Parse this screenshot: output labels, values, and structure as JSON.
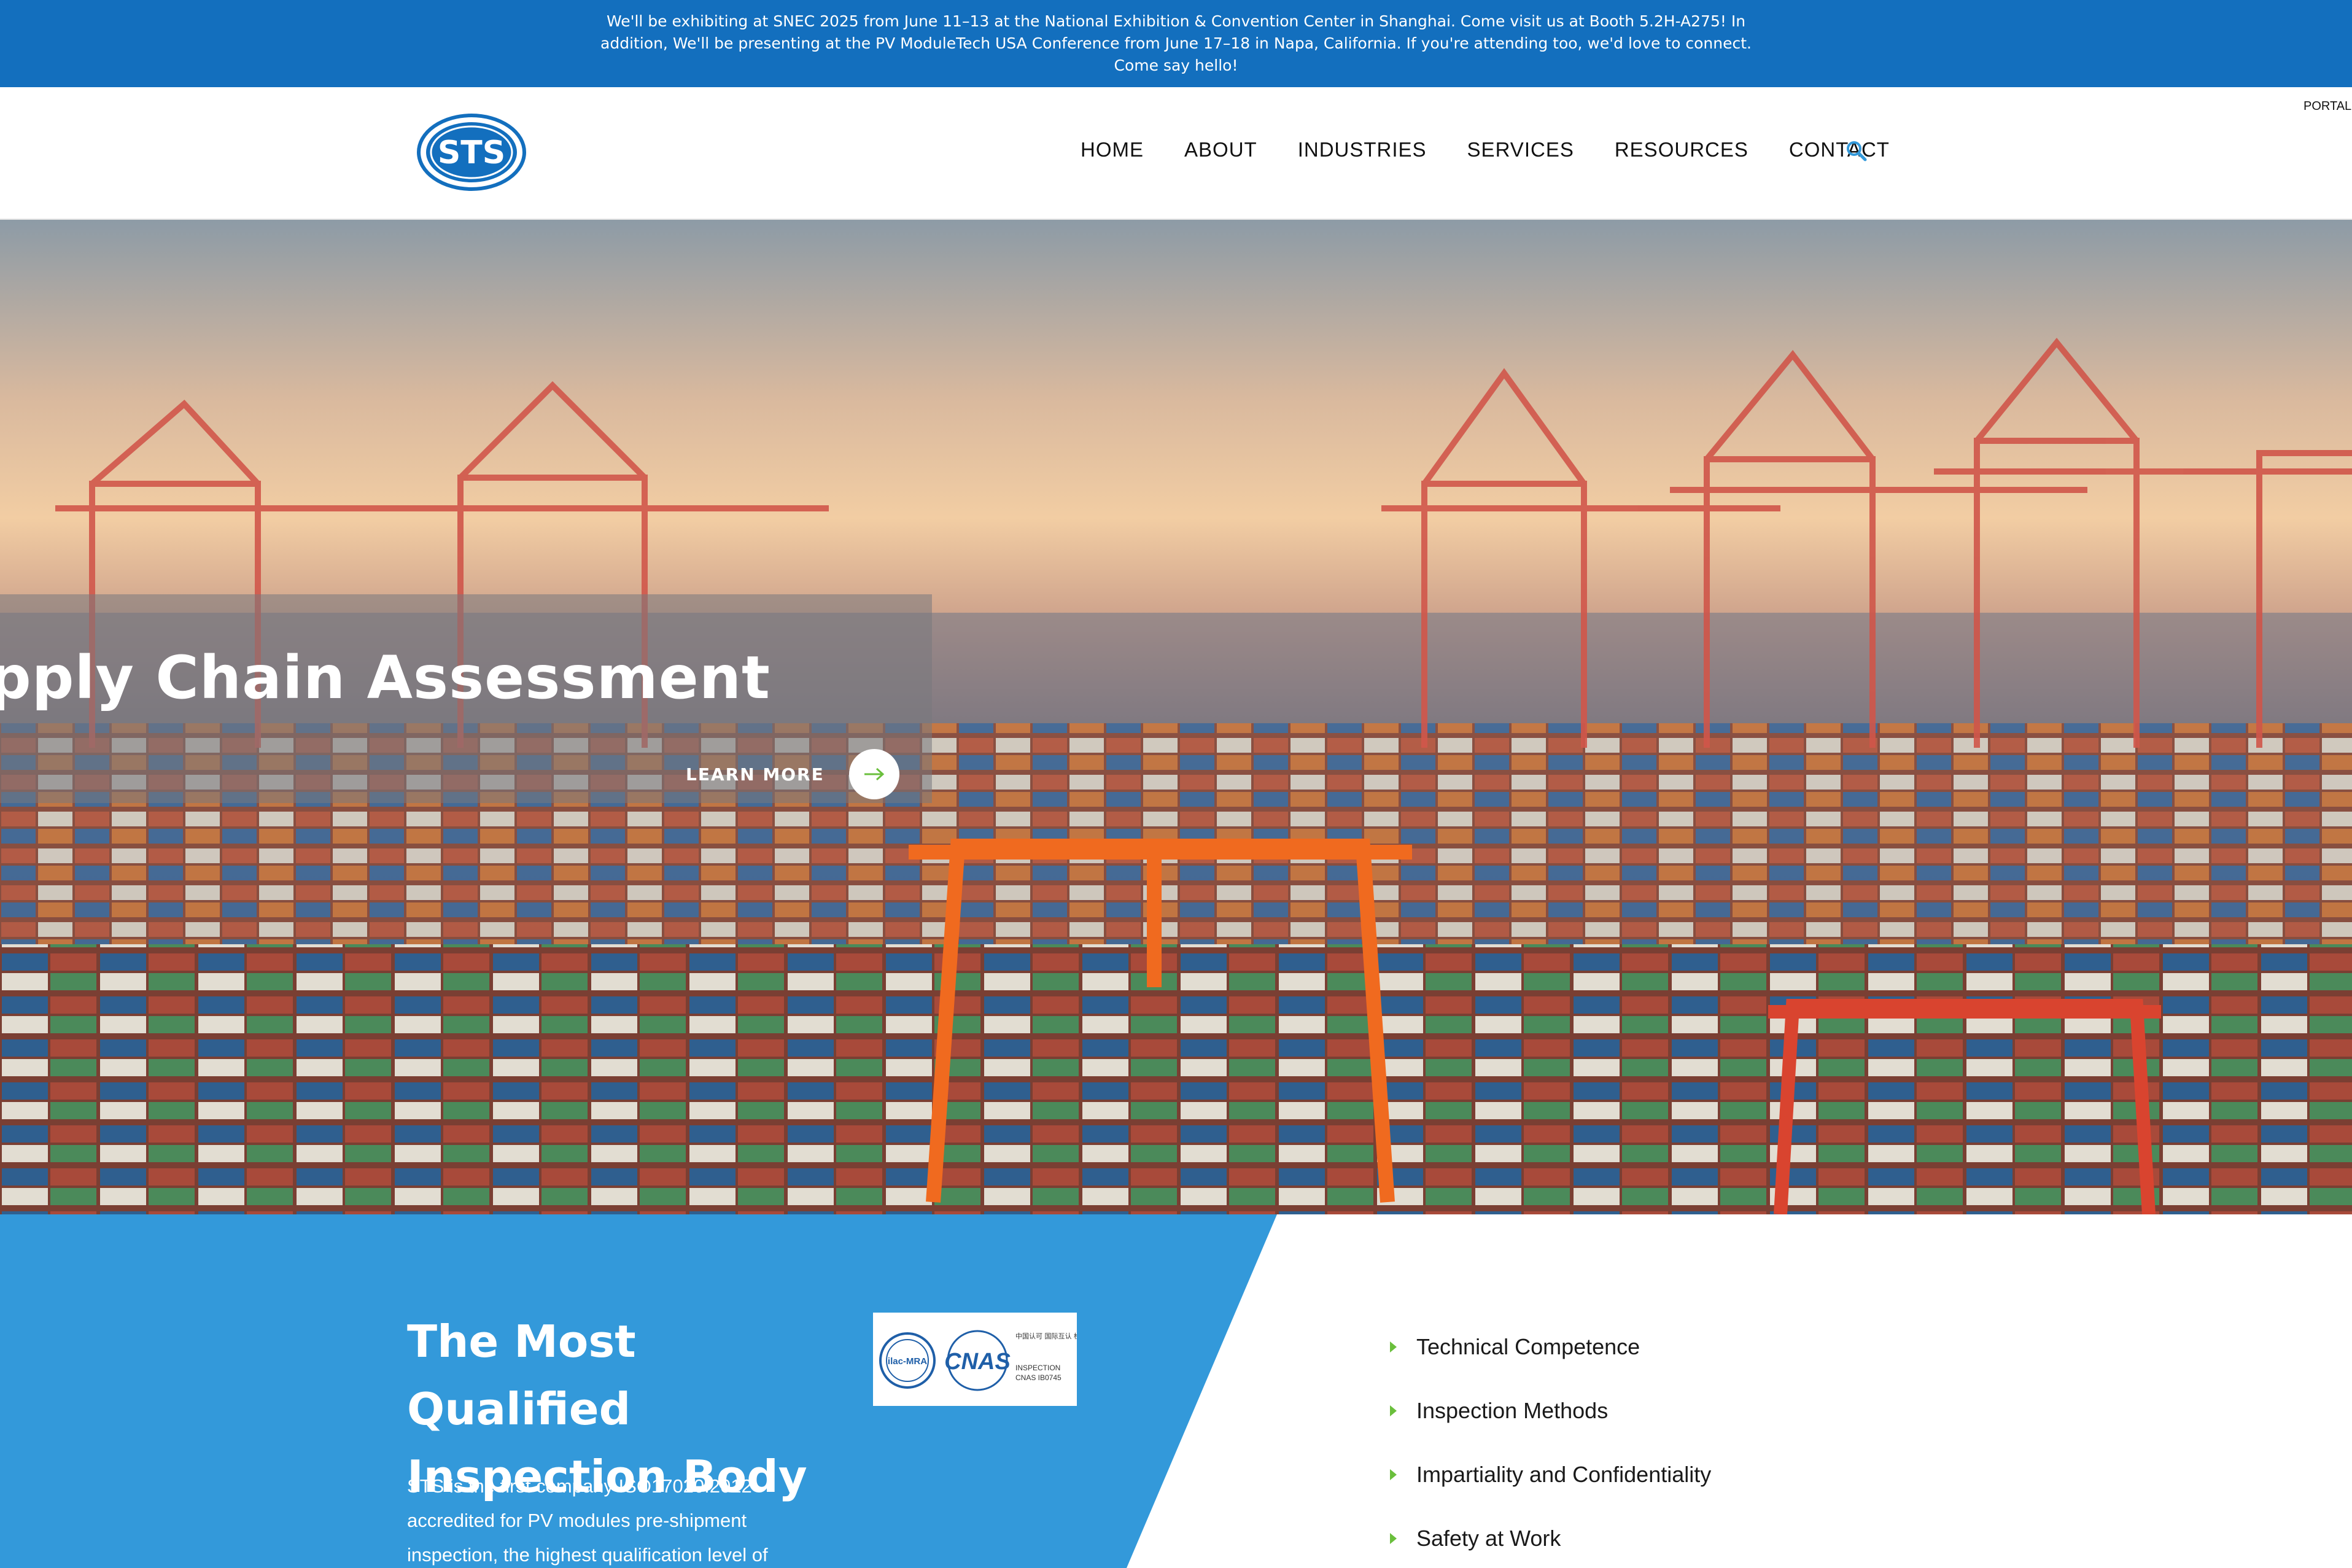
{
  "announcement": {
    "text": "We'll be exhibiting at SNEC 2025 from June 11–13 at the National Exhibition & Convention Center in Shanghai. Come visit us at Booth 5.2H-A275! In addition, We'll be presenting at the PV ModuleTech USA Conference from June 17–18 in Napa, California. If you're attending too, we'd love to connect. Come say hello!",
    "background": "#136fbe"
  },
  "header": {
    "logo_text": "STS",
    "portal_label": "PORTAL",
    "nav": [
      {
        "label": "HOME"
      },
      {
        "label": "ABOUT"
      },
      {
        "label": "INDUSTRIES"
      },
      {
        "label": "SERVICES"
      },
      {
        "label": "RESOURCES"
      },
      {
        "label": "CONTACT"
      }
    ],
    "search_icon": "search-icon"
  },
  "hero": {
    "title": "pply Chain Assessment",
    "cta_label": "LEARN MORE",
    "cta_icon": "arrow-right-icon",
    "accent": "#6abf3c"
  },
  "qualification": {
    "title": "The Most Qualified Inspection Body",
    "body": "STS is the first company ISO17020:2012 accredited for PV modules pre-shipment inspection, the highest qualification level of",
    "panel_color": "#3399da",
    "badge": {
      "ilac": "ilac-MRA",
      "cnas": "CNAS",
      "chinese": "中国认可 国际互认 检验",
      "inspection": "INSPECTION",
      "code": "CNAS IB0745"
    },
    "features": [
      "Technical Competence",
      "Inspection Methods",
      "Impartiality and Confidentiality",
      "Safety at Work"
    ]
  }
}
